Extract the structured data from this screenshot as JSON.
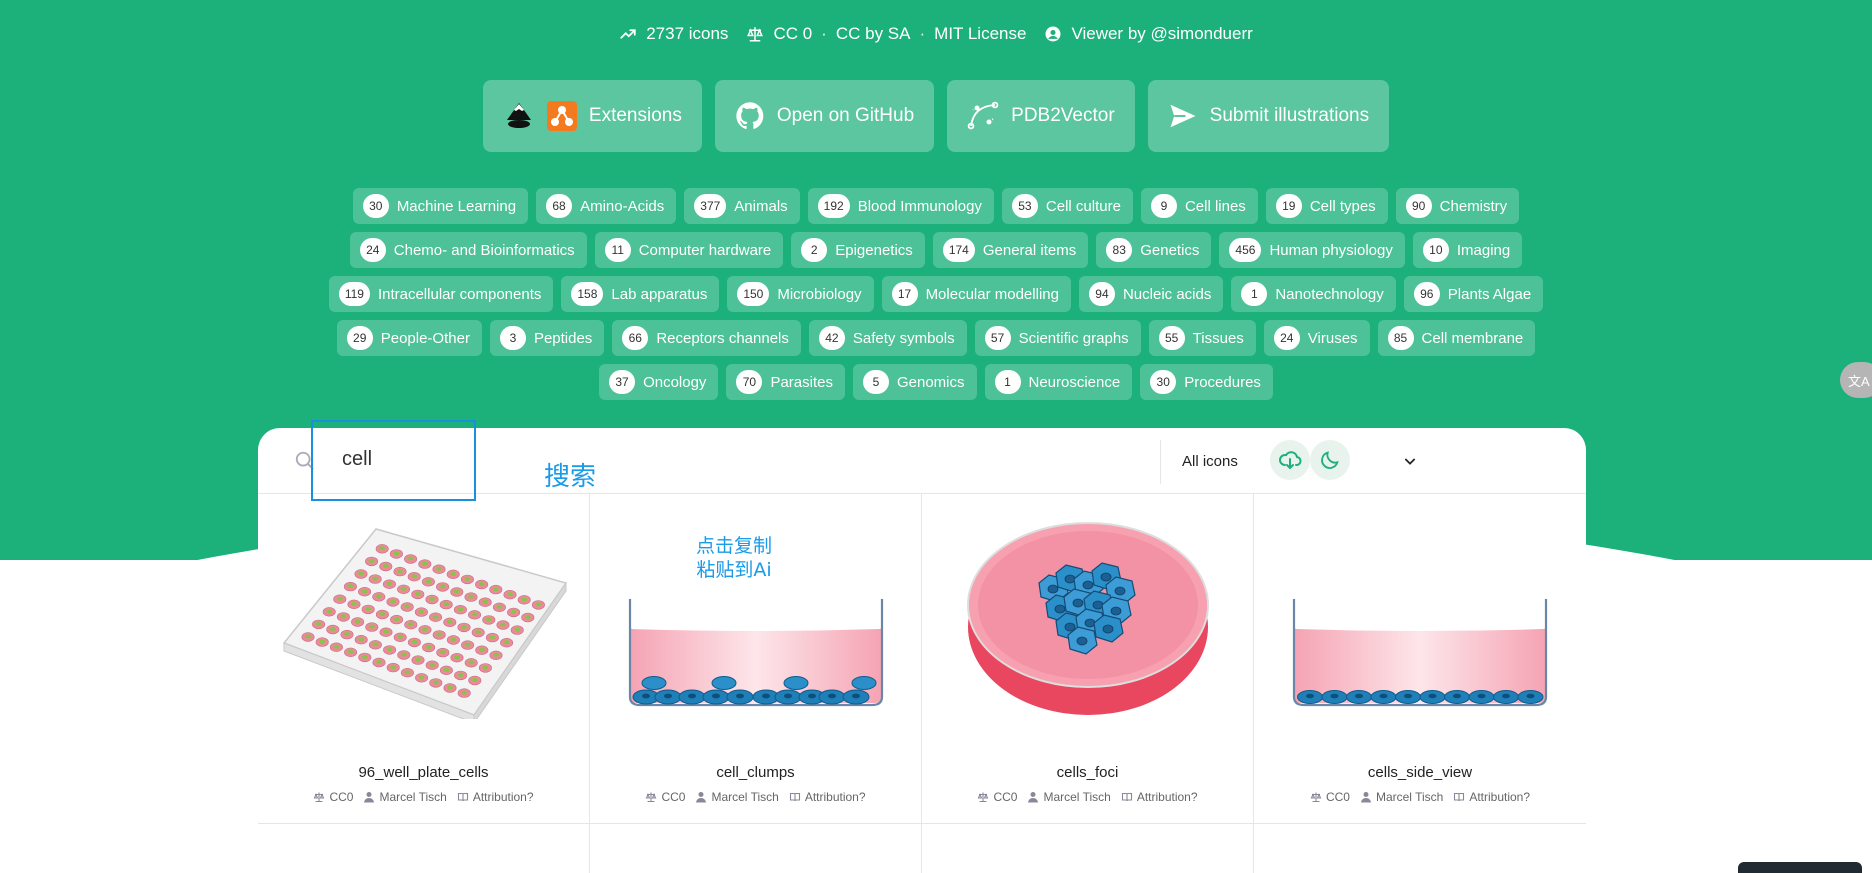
{
  "stats": {
    "icon_count": "2737 icons",
    "licenses": [
      "CC 0",
      "CC by SA",
      "MIT License"
    ],
    "viewer": "Viewer by @simonduerr"
  },
  "buttons": [
    {
      "label": "Extensions",
      "icon": "inkscape-and-extensions-icon"
    },
    {
      "label": "Open on GitHub",
      "icon": "github-icon"
    },
    {
      "label": "PDB2Vector",
      "icon": "bezier-curve-icon"
    },
    {
      "label": "Submit illustrations",
      "icon": "send-icon"
    }
  ],
  "tags": [
    {
      "count": "30",
      "label": "Machine Learning"
    },
    {
      "count": "68",
      "label": "Amino-Acids"
    },
    {
      "count": "377",
      "label": "Animals"
    },
    {
      "count": "192",
      "label": "Blood Immunology"
    },
    {
      "count": "53",
      "label": "Cell culture"
    },
    {
      "count": "9",
      "label": "Cell lines"
    },
    {
      "count": "19",
      "label": "Cell types"
    },
    {
      "count": "90",
      "label": "Chemistry"
    },
    {
      "count": "24",
      "label": "Chemo- and Bioinformatics"
    },
    {
      "count": "11",
      "label": "Computer hardware"
    },
    {
      "count": "2",
      "label": "Epigenetics"
    },
    {
      "count": "174",
      "label": "General items"
    },
    {
      "count": "83",
      "label": "Genetics"
    },
    {
      "count": "456",
      "label": "Human physiology"
    },
    {
      "count": "10",
      "label": "Imaging"
    },
    {
      "count": "119",
      "label": "Intracellular components"
    },
    {
      "count": "158",
      "label": "Lab apparatus"
    },
    {
      "count": "150",
      "label": "Microbiology"
    },
    {
      "count": "17",
      "label": "Molecular modelling"
    },
    {
      "count": "94",
      "label": "Nucleic acids"
    },
    {
      "count": "1",
      "label": "Nanotechnology"
    },
    {
      "count": "96",
      "label": "Plants Algae"
    },
    {
      "count": "29",
      "label": "People-Other"
    },
    {
      "count": "3",
      "label": "Peptides"
    },
    {
      "count": "66",
      "label": "Receptors channels"
    },
    {
      "count": "42",
      "label": "Safety symbols"
    },
    {
      "count": "57",
      "label": "Scientific graphs"
    },
    {
      "count": "55",
      "label": "Tissues"
    },
    {
      "count": "24",
      "label": "Viruses"
    },
    {
      "count": "85",
      "label": "Cell membrane"
    },
    {
      "count": "37",
      "label": "Oncology"
    },
    {
      "count": "70",
      "label": "Parasites"
    },
    {
      "count": "5",
      "label": "Genomics"
    },
    {
      "count": "1",
      "label": "Neuroscience"
    },
    {
      "count": "30",
      "label": "Procedures"
    }
  ],
  "translate_fab": "文A",
  "search": {
    "value": "cell",
    "annotation": "搜索",
    "filter_selected": "All icons"
  },
  "cards": [
    {
      "name": "96_well_plate_cells",
      "license": "CC0",
      "author": "Marcel Tisch",
      "attribution": "Attribution?"
    },
    {
      "name": "cell_clumps",
      "license": "CC0",
      "author": "Marcel Tisch",
      "attribution": "Attribution?",
      "note_line1": "点击复制",
      "note_line2": "粘贴到Ai"
    },
    {
      "name": "cells_foci",
      "license": "CC0",
      "author": "Marcel Tisch",
      "attribution": "Attribution?"
    },
    {
      "name": "cells_side_view",
      "license": "CC0",
      "author": "Marcel Tisch",
      "attribution": "Attribution?"
    }
  ],
  "colors": {
    "brand": "#1cb07a",
    "annotation_blue": "#1a9be8",
    "medium_pink": "#f7b8c4",
    "dish_red": "#e34c6e",
    "cell_blue": "#2b8fc9"
  }
}
